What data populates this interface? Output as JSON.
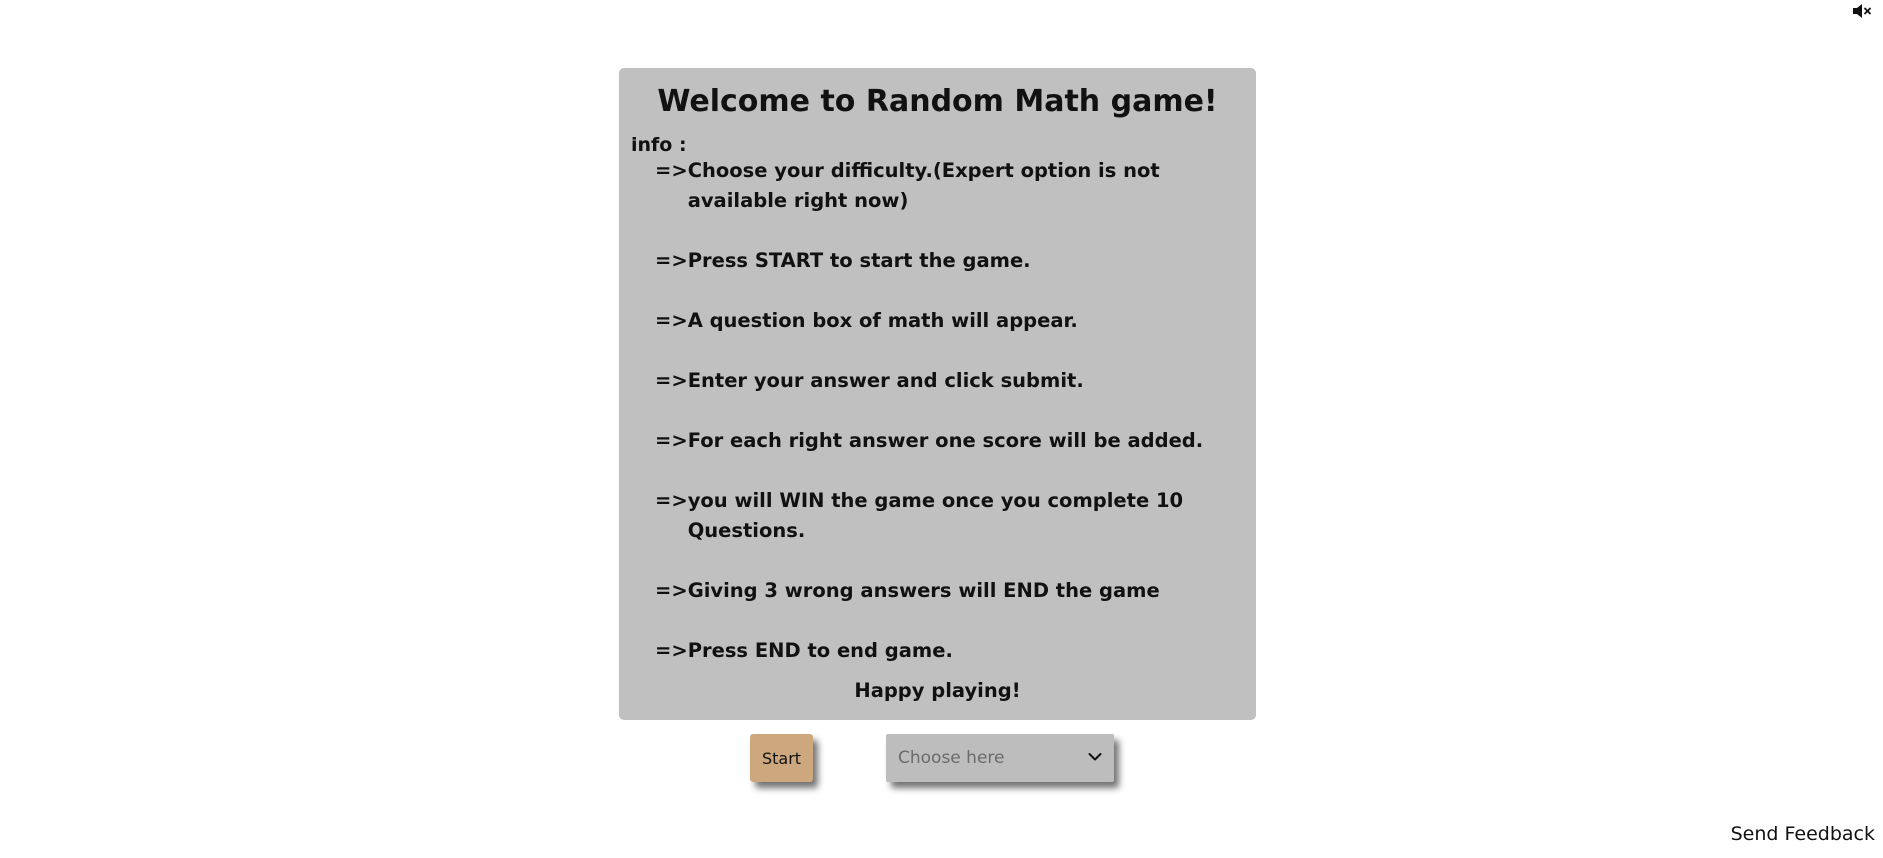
{
  "mute_button": {
    "icon": "speaker-muted-icon"
  },
  "panel": {
    "title": "Welcome to Random Math game!",
    "info_label": "info :",
    "arrow": "=>",
    "rules": [
      "Choose your difficulty.(Expert option is not available right now)",
      "Press START to start the game.",
      "A question box of math will appear.",
      "Enter your answer and click submit.",
      "For each right answer one score will be added.",
      "you will WIN the game once you complete 10 Questions.",
      "Giving 3 wrong answers will END the game",
      "Press END to end game."
    ],
    "closing": "Happy playing!",
    "background_color": "#c0c0c0"
  },
  "controls": {
    "start_label": "Start",
    "start_color": "#cda87e",
    "difficulty_placeholder": "Choose here",
    "difficulty_icon": "chevron-down-icon"
  },
  "footer": {
    "feedback_label": "Send Feedback"
  }
}
